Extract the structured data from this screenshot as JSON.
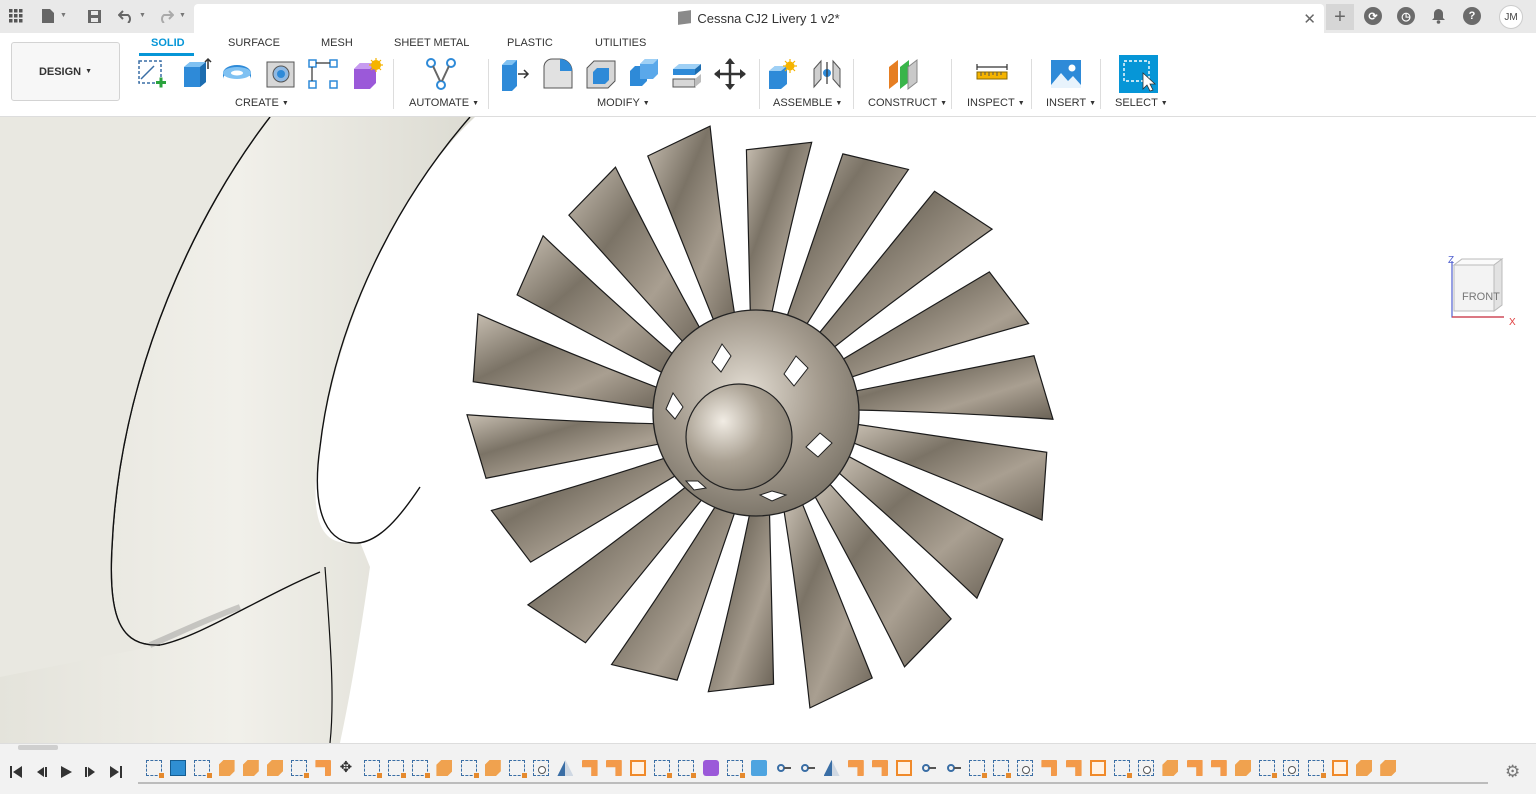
{
  "window": {
    "title": "Cessna CJ2 Livery 1 v2*",
    "user_initials": "JM"
  },
  "toolbar": {
    "workspace_button": "DESIGN",
    "tabs": [
      "SOLID",
      "SURFACE",
      "MESH",
      "SHEET METAL",
      "PLASTIC",
      "UTILITIES"
    ],
    "active_tab": "SOLID",
    "groups": {
      "create": "CREATE",
      "automate": "AUTOMATE",
      "modify": "MODIFY",
      "assemble": "ASSEMBLE",
      "construct": "CONSTRUCT",
      "inspect": "INSPECT",
      "insert": "INSERT",
      "select": "SELECT"
    },
    "tools": {
      "create": [
        "create-sketch-icon",
        "extrude-icon",
        "revolve-icon",
        "hole-icon",
        "rectangular-pattern-icon",
        "create-form-icon"
      ],
      "automate": [
        "automate-icon"
      ],
      "modify": [
        "press-pull-icon",
        "fillet-icon",
        "shell-icon",
        "combine-icon",
        "offset-face-icon",
        "move-icon"
      ],
      "assemble": [
        "new-component-icon",
        "joint-icon"
      ],
      "construct": [
        "offset-plane-icon"
      ],
      "inspect": [
        "measure-icon"
      ],
      "insert": [
        "insert-image-icon"
      ],
      "select": [
        "window-select-icon"
      ]
    },
    "accent_color": "#0696d7"
  },
  "viewport": {
    "viewcube_face": "FRONT",
    "axis_labels": {
      "z": "Z",
      "x": "X"
    },
    "model": "jet-engine-fan",
    "fan_blade_count": 18
  },
  "timeline": {
    "controls": [
      "first-icon",
      "previous-icon",
      "play-icon",
      "next-icon",
      "last-icon"
    ],
    "features": [
      "sketch",
      "canvas",
      "sketch",
      "fillet",
      "fillet",
      "fillet",
      "sketch",
      "extrude",
      "move",
      "sketch",
      "sketch",
      "sketch",
      "fillet",
      "sketch",
      "fillet",
      "sketch",
      "hole",
      "mirror",
      "extrude",
      "extrude",
      "pattern",
      "sketch",
      "sketch",
      "form",
      "sketch",
      "body",
      "joint",
      "joint",
      "mirror",
      "extrude",
      "extrude",
      "pattern",
      "joint",
      "joint",
      "sketch",
      "sketch",
      "hole",
      "extrude",
      "extrude",
      "pattern",
      "sketch",
      "hole",
      "fillet",
      "extrude",
      "extrude",
      "fillet",
      "sketch",
      "hole",
      "sketch",
      "pattern",
      "fillet",
      "fillet"
    ]
  }
}
